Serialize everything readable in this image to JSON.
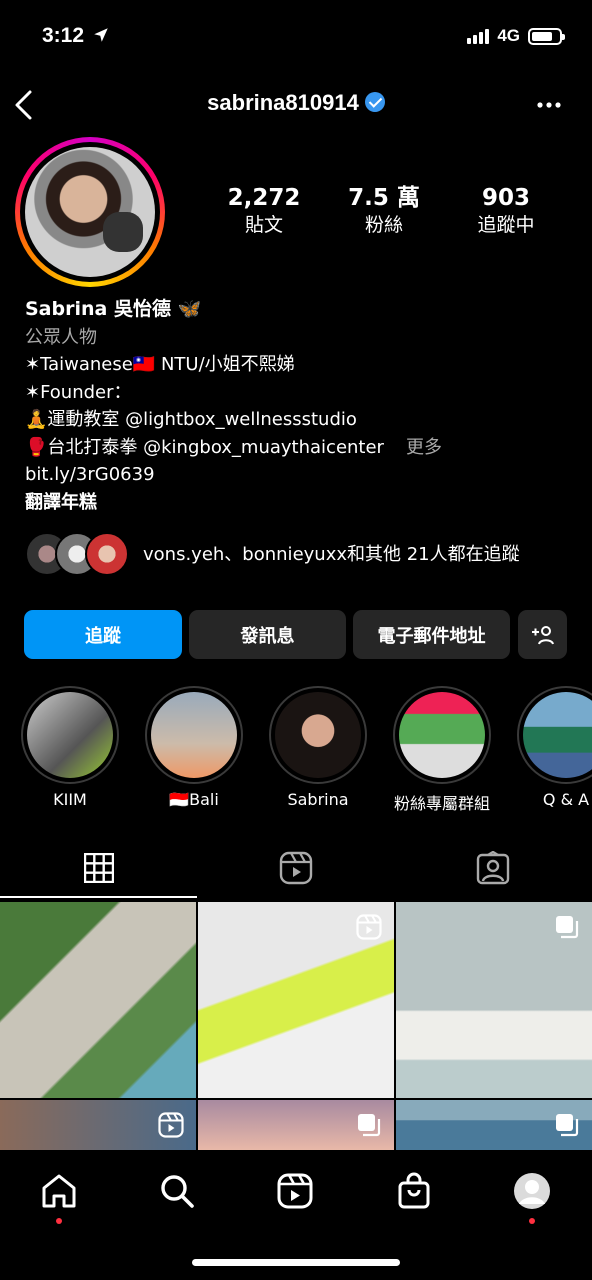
{
  "status_bar": {
    "time": "3:12",
    "network": "4G"
  },
  "header": {
    "username": "sabrina810914"
  },
  "stats": [
    {
      "value": "2,272",
      "label": "貼文"
    },
    {
      "value": "7.5 萬",
      "label": "粉絲"
    },
    {
      "value": "903",
      "label": "追蹤中"
    }
  ],
  "bio": {
    "name": "Sabrina 吳怡德 🦋",
    "category": "公眾人物",
    "lines": [
      "✶Taiwanese🇹🇼 NTU/小姐不熙娣",
      "✶Founder：",
      "🧘運動教室 @lightbox_wellnessstudio",
      "🥊台北打泰拳 @kingbox_muaythaicenter"
    ],
    "more": "更多",
    "link": "bit.ly/3rG0639",
    "translate": "翻譯年糕"
  },
  "followed_by": "vons.yeh、bonnieyuxx和其他 21人都在追蹤",
  "buttons": {
    "follow": "追蹤",
    "message": "發訊息",
    "email": "電子郵件地址",
    "add": "+👤"
  },
  "highlights": [
    {
      "label": "KIIM"
    },
    {
      "label": "🇮🇩Bali"
    },
    {
      "label": "Sabrina"
    },
    {
      "label": "粉絲專屬群組"
    },
    {
      "label": "Q & A"
    }
  ],
  "colors": {
    "accent": "#0095f6",
    "button_dark": "#262626",
    "notification": "#ff3040"
  }
}
